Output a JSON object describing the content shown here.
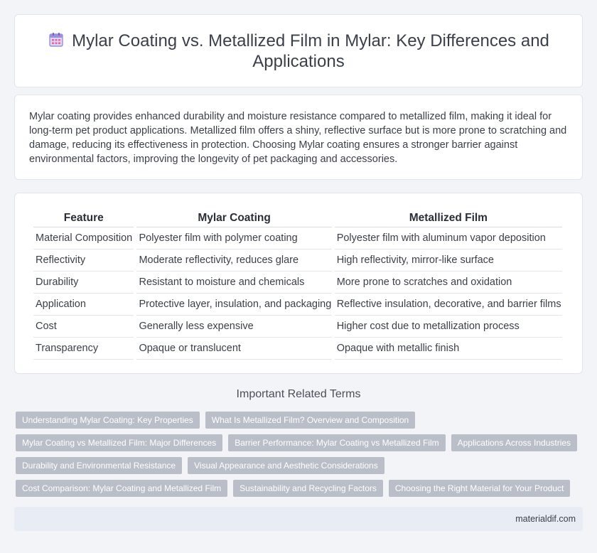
{
  "header": {
    "title_icon": "calendar-icon",
    "title": "Mylar Coating vs. Metallized Film in Mylar: Key Differences and Applications"
  },
  "summary": "Mylar coating provides enhanced durability and moisture resistance compared to metallized film, making it ideal for long-term pet product applications. Metallized film offers a shiny, reflective surface but is more prone to scratching and damage, reducing its effectiveness in protection. Choosing Mylar coating ensures a stronger barrier against environmental factors, improving the longevity of pet packaging and accessories.",
  "table": {
    "headers": [
      "Feature",
      "Mylar Coating",
      "Metallized Film"
    ],
    "rows": [
      [
        "Material Composition",
        "Polyester film with polymer coating",
        "Polyester film with aluminum vapor deposition"
      ],
      [
        "Reflectivity",
        "Moderate reflectivity, reduces glare",
        "High reflectivity, mirror-like surface"
      ],
      [
        "Durability",
        "Resistant to moisture and chemicals",
        "More prone to scratches and oxidation"
      ],
      [
        "Application",
        "Protective layer, insulation, and packaging",
        "Reflective insulation, decorative, and barrier films"
      ],
      [
        "Cost",
        "Generally less expensive",
        "Higher cost due to metallization process"
      ],
      [
        "Transparency",
        "Opaque or translucent",
        "Opaque with metallic finish"
      ]
    ]
  },
  "related": {
    "heading": "Important Related Terms",
    "rows": [
      [
        "Understanding Mylar Coating: Key Properties",
        "What Is Metallized Film? Overview and Composition"
      ],
      [
        "Mylar Coating vs Metallized Film: Major Differences",
        "Barrier Performance: Mylar Coating vs Metallized Film",
        "Applications Across Industries"
      ],
      [
        "Durability and Environmental Resistance",
        "Visual Appearance and Aesthetic Considerations"
      ],
      [
        "Cost Comparison: Mylar Coating and Metallized Film",
        "Sustainability and Recycling Factors",
        "Choosing the Right Material for Your Product"
      ]
    ]
  },
  "footer": {
    "site": "materialdif.com"
  }
}
